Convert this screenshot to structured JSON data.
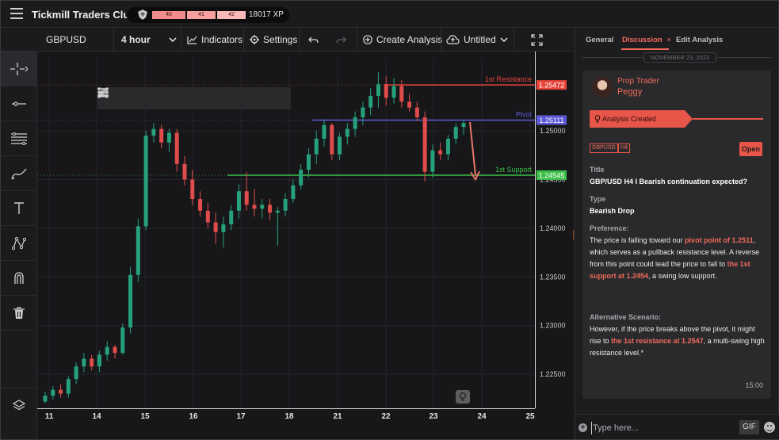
{
  "app": {
    "title": "Tickmill Traders Club",
    "xp_segments": [
      "40",
      "41",
      "42"
    ],
    "xp_value": "18017 XP"
  },
  "toolbar": {
    "symbol": "GBPUSD",
    "interval": "4 hour",
    "indicators": "Indicators",
    "settings": "Settings",
    "create_analysis": "Create Analysis",
    "untitled": "Untitled"
  },
  "left_tools": [
    "crosshair-icon",
    "horizontal-line-icon",
    "fib-lines-icon",
    "brush-icon",
    "text-icon",
    "pattern-icon",
    "magnet-icon",
    "trash-icon",
    "layers-icon"
  ],
  "chart_data": {
    "type": "candlestick",
    "x_tick_labels": [
      "11",
      "14",
      "15",
      "16",
      "17",
      "18",
      "21",
      "22",
      "23",
      "24",
      "25"
    ],
    "y_tick_labels": [
      "1.25000",
      "1.24500",
      "1.24000",
      "1.23500",
      "1.23000",
      "1.22500"
    ],
    "ylim": [
      1.2215,
      1.2575
    ],
    "levels": [
      {
        "name": "1st Resistance",
        "value": 1.25472,
        "label": "1.25472",
        "color": "#e8443a"
      },
      {
        "name": "Pivot",
        "value": 1.25111,
        "label": "1.25111",
        "color": "#5b5bd6"
      },
      {
        "name": "1st Support",
        "value": 1.24545,
        "label": "1.24545",
        "color": "#3cc04a"
      }
    ],
    "candles_ohlc": [
      [
        1.2222,
        1.2232,
        1.222,
        1.2228
      ],
      [
        1.2228,
        1.2238,
        1.2224,
        1.2234
      ],
      [
        1.2234,
        1.224,
        1.2226,
        1.223
      ],
      [
        1.223,
        1.2248,
        1.2226,
        1.2245
      ],
      [
        1.2245,
        1.2262,
        1.224,
        1.2258
      ],
      [
        1.2258,
        1.2272,
        1.2252,
        1.2266
      ],
      [
        1.2266,
        1.227,
        1.2254,
        1.2258
      ],
      [
        1.2258,
        1.2274,
        1.2252,
        1.227
      ],
      [
        1.227,
        1.2284,
        1.2264,
        1.2278
      ],
      [
        1.2278,
        1.228,
        1.2266,
        1.2272
      ],
      [
        1.2272,
        1.2302,
        1.227,
        1.2298
      ],
      [
        1.2298,
        1.236,
        1.2292,
        1.2352
      ],
      [
        1.2352,
        1.241,
        1.2345,
        1.2402
      ],
      [
        1.2402,
        1.25,
        1.2398,
        1.2495
      ],
      [
        1.2495,
        1.2508,
        1.2488,
        1.2502
      ],
      [
        1.2502,
        1.2506,
        1.2482,
        1.2488
      ],
      [
        1.2488,
        1.2502,
        1.2478,
        1.2498
      ],
      [
        1.2498,
        1.2502,
        1.2458,
        1.2466
      ],
      [
        1.2466,
        1.2474,
        1.2444,
        1.245
      ],
      [
        1.245,
        1.246,
        1.2424,
        1.243
      ],
      [
        1.243,
        1.2438,
        1.2412,
        1.2418
      ],
      [
        1.2418,
        1.2426,
        1.24,
        1.2406
      ],
      [
        1.2406,
        1.2416,
        1.2384,
        1.2396
      ],
      [
        1.2396,
        1.2412,
        1.238,
        1.2404
      ],
      [
        1.2404,
        1.2424,
        1.2398,
        1.2418
      ],
      [
        1.2418,
        1.2445,
        1.241,
        1.2438
      ],
      [
        1.2438,
        1.2458,
        1.2418,
        1.2424
      ],
      [
        1.2424,
        1.244,
        1.2412,
        1.242
      ],
      [
        1.242,
        1.243,
        1.241,
        1.2424
      ],
      [
        1.2424,
        1.243,
        1.2408,
        1.2416
      ],
      [
        1.2416,
        1.2422,
        1.2382,
        1.2418
      ],
      [
        1.2418,
        1.2436,
        1.2412,
        1.243
      ],
      [
        1.243,
        1.245,
        1.2426,
        1.2444
      ],
      [
        1.2444,
        1.2466,
        1.244,
        1.246
      ],
      [
        1.246,
        1.2482,
        1.2452,
        1.2476
      ],
      [
        1.2476,
        1.25,
        1.2466,
        1.2492
      ],
      [
        1.2492,
        1.2512,
        1.2484,
        1.2506
      ],
      [
        1.2506,
        1.2508,
        1.247,
        1.2476
      ],
      [
        1.2476,
        1.2498,
        1.247,
        1.2494
      ],
      [
        1.2494,
        1.2508,
        1.2486,
        1.2502
      ],
      [
        1.2502,
        1.252,
        1.2494,
        1.2514
      ],
      [
        1.2514,
        1.253,
        1.2506,
        1.2524
      ],
      [
        1.2524,
        1.2544,
        1.2516,
        1.2536
      ],
      [
        1.2536,
        1.256,
        1.2524,
        1.2548
      ],
      [
        1.2548,
        1.2556,
        1.2526,
        1.2534
      ],
      [
        1.2534,
        1.2554,
        1.2528,
        1.2546
      ],
      [
        1.2546,
        1.2552,
        1.2524,
        1.253
      ],
      [
        1.253,
        1.2538,
        1.252,
        1.2524
      ],
      [
        1.2524,
        1.253,
        1.251,
        1.2514
      ],
      [
        1.2514,
        1.252,
        1.2448,
        1.2458
      ],
      [
        1.2458,
        1.2486,
        1.2452,
        1.248
      ],
      [
        1.248,
        1.2488,
        1.247,
        1.2476
      ],
      [
        1.2476,
        1.2496,
        1.247,
        1.2492
      ],
      [
        1.2492,
        1.2508,
        1.2486,
        1.2504
      ],
      [
        1.2504,
        1.2512,
        1.2496,
        1.2508
      ]
    ]
  },
  "panel": {
    "tabs": [
      "General",
      "Discussion",
      "Edit Analysis"
    ],
    "tab_close": "×",
    "date": "NOVEMBER 23, 2023",
    "role": "Prop Trader",
    "user": "Peggy",
    "status": "Analysis Created",
    "tags": [
      "GBPUSD",
      "H4"
    ],
    "open_label": "Open",
    "title_label": "Title",
    "title_value": "GBP/USD H4 I Bearish continuation expected?",
    "type_label": "Type",
    "type_value": "Bearish Drop",
    "pref_label": "Preference:",
    "pref_text": {
      "t1": "The price is falling toward our ",
      "h1": "pivot point of 1.2511",
      "t2": ", which serves as a pullback resistance level. A reverse from this point could lead the price to fall to ",
      "h2": "the 1st support at 1.2454",
      "t3": ", a swing low support."
    },
    "alt_label": "Alternative Scenario:",
    "alt_text": {
      "t1": "However, if the price breaks above the pivot, it might rise to ",
      "h1": "the 1st resistance at 1.2547",
      "t2": ",  a multi-swing high resistance level.*"
    },
    "time": "15:00",
    "composer_placeholder": "Type here...",
    "gif_label": "GIF"
  }
}
